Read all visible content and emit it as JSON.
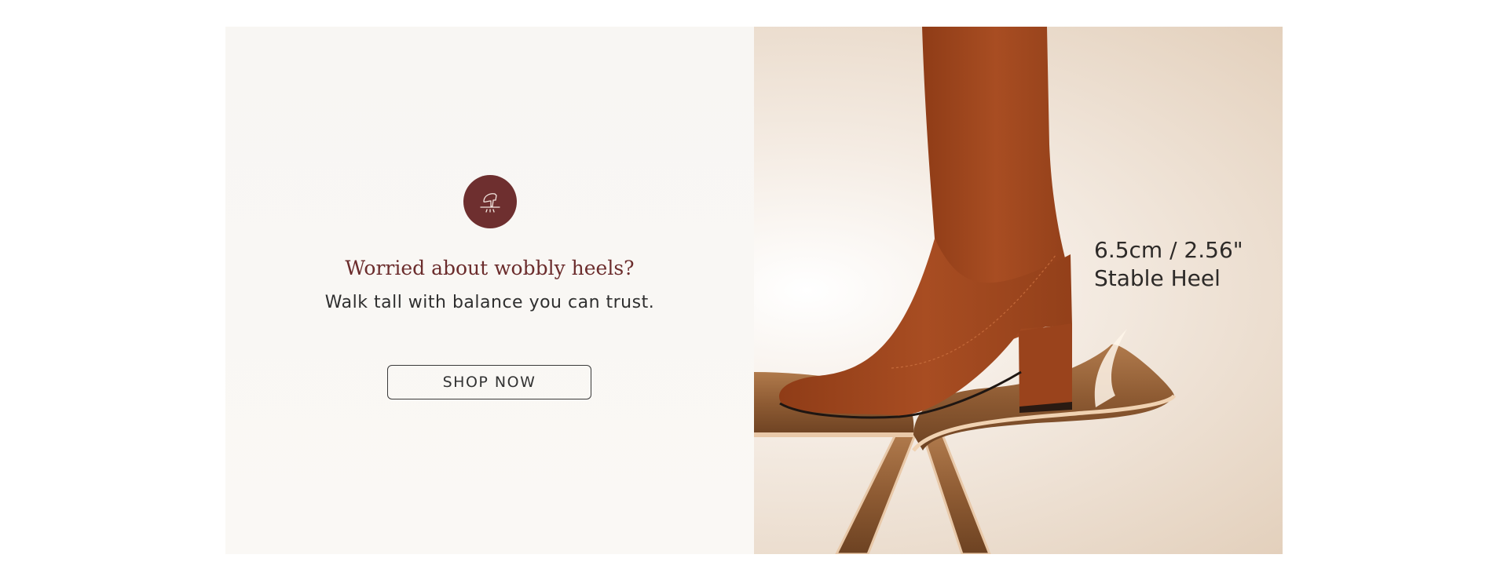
{
  "promo": {
    "icon": "high-heel-icon",
    "headline": "Worried about wobbly heels?",
    "subline": "Walk tall with balance you can trust.",
    "cta_label": "SHOP NOW"
  },
  "product": {
    "heel_measure": "6.5cm / 2.56\"",
    "heel_label": "Stable Heel",
    "image": "brown-suede-knee-boot-on-wooden-stool"
  },
  "colors": {
    "accent": "#6e2f2f",
    "headline": "#6b2c2c",
    "boot": "#a3491f",
    "left_bg": "#f8f6f3",
    "right_bg": "#e3d0bc"
  }
}
